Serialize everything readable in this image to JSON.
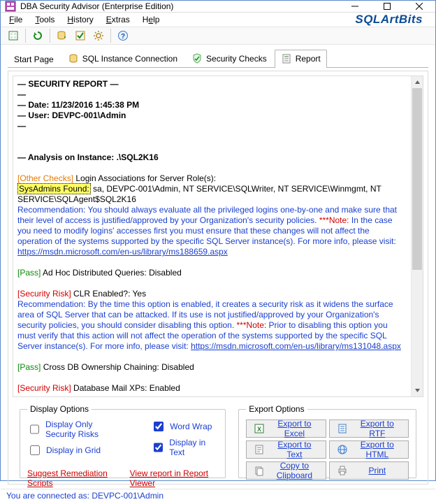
{
  "window": {
    "title": "DBA Security Advisor (Enterprise Edition)"
  },
  "brand": "SQLArtBits",
  "menu": {
    "file": "File",
    "tools": "Tools",
    "history": "History",
    "extras": "Extras",
    "help": "Help"
  },
  "tabs": {
    "start": "Start Page",
    "conn": "SQL Instance Connection",
    "checks": "Security Checks",
    "report": "Report"
  },
  "report": {
    "heading": "— SECURITY REPORT —",
    "date_line": "— Date: 11/23/2016 1:45:38 PM",
    "user_line": "— User: DEVPC-001\\Admin",
    "dash1": "—",
    "dash2": "—",
    "analysis": "— Analysis on Instance: .\\SQL2K16",
    "other_checks_tag": "[Other Checks]",
    "login_assoc": " Login Associations for Server Role(s):",
    "sysadmins_label": "SysAdmins Found:",
    "sysadmins_list": " sa, DEVPC-001\\Admin, NT SERVICE\\SQLWriter, NT SERVICE\\Winmgmt, NT SERVICE\\SQLAgent$SQL2K16",
    "rec1a": "Recommendation: You should always evaluate all the privileged logins one-by-one and make sure that their level of access is justified/approved by your Organization's security policies. ",
    "rec1_note_label": "***Note:",
    "rec1b": " In the case you need to modify logins' accesses first you must ensure that these changes will not affect the operation of the systems supported by the specific SQL Server instance(s). For more info, please visit: ",
    "rec1_link": "https://msdn.microsoft.com/en-us/library/ms188659.aspx",
    "pass1_tag": "[Pass]",
    "pass1_text": " Ad Hoc Distributed Queries: Disabled",
    "risk1_tag": "[Security Risk]",
    "risk1_text": " CLR Enabled?: Yes",
    "rec2a": "Recommendation: By the time this option is enabled, it creates a security risk as it widens the surface area of SQL Server that can be attacked. If its use is not justified/approved by your Organization's security policies, you should consider disabling this option. ",
    "rec2_note_label": "***Note:",
    "rec2b": " Prior to disabling this option you must verify that this action will not affect the operation of the systems supported by the specific SQL Server instance(s). For more info, please visit: ",
    "rec2_link": "https://msdn.microsoft.com/en-us/library/ms131048.aspx",
    "pass2_tag": "[Pass]",
    "pass2_text": " Cross DB Ownership Chaining: Disabled",
    "risk2_tag": "[Security Risk]",
    "risk2_text": " Database Mail XPs: Enabled"
  },
  "display_options": {
    "legend": "Display Options",
    "only_risks": "Display Only Security Risks",
    "in_grid": "Display in Grid",
    "word_wrap": "Word Wrap",
    "in_text": "Display in Text",
    "suggest": "Suggest Remediation Scripts",
    "view_report": "View report in Report Viewer"
  },
  "export_options": {
    "legend": "Export Options",
    "excel": "Export to Excel",
    "rtf": "Export to RTF",
    "text": "Export to Text",
    "html": "Export to HTML",
    "copy": "Copy to Clipboard",
    "print": "Print"
  },
  "statusbar": "You are connected as: DEVPC-001\\Admin"
}
